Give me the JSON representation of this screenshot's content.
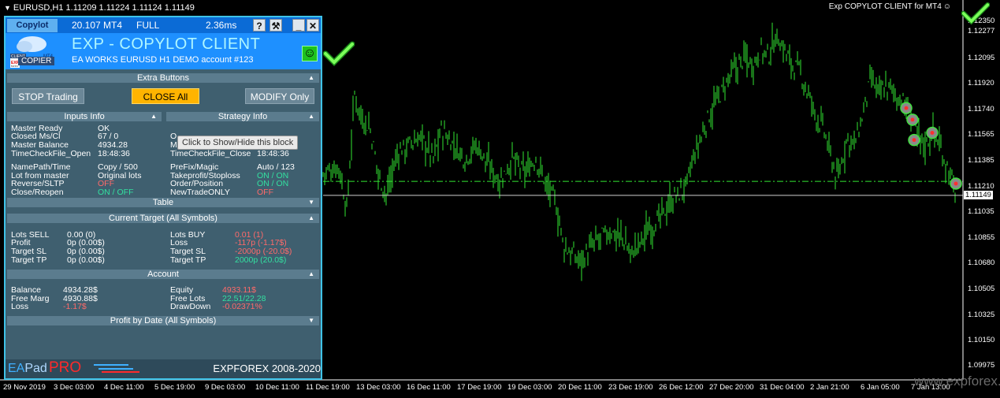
{
  "window": {
    "symbol_quote": "EURUSD,H1  1.11209 1.11224 1.11124 1.11149"
  },
  "chart_label": "Exp COPYLOT CLIENT for MT4",
  "panel": {
    "tab": "Copylot",
    "version": "20.107 MT4",
    "mode": "FULL",
    "ping": "2.36ms",
    "btn_help": "?",
    "btn_tools": "⚒",
    "btn_min": "_",
    "btn_close": "✕",
    "title": "EXP - COPYLOT CLIENT",
    "subtitle": "EA WORKS EURUSD  H1 DEMO account   #123",
    "copier": "COPIER",
    "logo_client": "CLIENT",
    "logo_mt4": "MT4",
    "logo_exp": "EXP",
    "logo_forex": "forex",
    "smile": "☺"
  },
  "sections": {
    "extra": "Extra Buttons",
    "inputs": "Inputs Info",
    "strategy": "Strategy Info",
    "table": "Table",
    "target": "Current Target (All Symbols)",
    "account": "Account",
    "profit": "Profit by Date (All Symbols)"
  },
  "buttons": {
    "stop": "STOP Trading",
    "close": "CLOSE All",
    "modify": "MODIFY Only"
  },
  "inputs": [
    {
      "label": "Master Ready",
      "value": "OK"
    },
    {
      "label": "Closed Ms/Cl",
      "value": "67 / 0"
    },
    {
      "label": "Master Balance",
      "value": "4934.28"
    },
    {
      "label": "TimeCheckFile_Open",
      "value": "18:48:36"
    },
    {
      "label": "NamePath/Time",
      "value": "Copy / 500"
    },
    {
      "label": "Lot from master",
      "value": "Original lots"
    },
    {
      "label": "Reverse/SLTP",
      "value": "OFF"
    },
    {
      "label": "Close/Reopen",
      "value": "ON / OFF"
    }
  ],
  "strategy": [
    {
      "label": "O",
      "value": ""
    },
    {
      "label": "M",
      "value": ""
    },
    {
      "label": "TimeCheckFile_Close",
      "value": "18:48:36"
    },
    {
      "label": "PreFix/Magic",
      "value": "Auto / 123"
    },
    {
      "label": "Takeprofit/Stoploss",
      "value": "ON / ON"
    },
    {
      "label": "Order/Position",
      "value": "ON / ON"
    },
    {
      "label": "NewTradeONLY",
      "value": "OFF"
    }
  ],
  "tooltip": "Click to Show/Hide this block",
  "target_left": [
    {
      "label": "Lots SELL",
      "value": "0.00 (0)"
    },
    {
      "label": "Profit",
      "value": "0p (0.00$)"
    },
    {
      "label": "Target SL",
      "value": "0p (0.00$)"
    },
    {
      "label": "Target TP",
      "value": "0p (0.00$)"
    }
  ],
  "target_right": [
    {
      "label": "Lots BUY",
      "value": "0.01 (1)"
    },
    {
      "label": "Loss",
      "value": "-117p (-1.17$)"
    },
    {
      "label": "Target SL",
      "value": "-2000p (-20.0$)"
    },
    {
      "label": "Target TP",
      "value": "2000p (20.0$)"
    }
  ],
  "account_left": [
    {
      "label": "Balance",
      "value": "4934.28$"
    },
    {
      "label": "Free Marg",
      "value": "4930.88$"
    },
    {
      "label": "Loss",
      "value": "-1.17$"
    }
  ],
  "account_right": [
    {
      "label": "Equity",
      "value": "4933.11$"
    },
    {
      "label": "Free Lots",
      "value": "22.51/22.28"
    },
    {
      "label": "DrawDown",
      "value": "-0.02371%"
    }
  ],
  "footer": {
    "ea": "EA",
    "pad": "Pad",
    "pro": "PRO",
    "copyright": "EXPFOREX 2008-2020"
  },
  "price_axis": [
    "1.12350",
    "1.12277",
    "1.12095",
    "1.11920",
    "1.11740",
    "1.11565",
    "1.11385",
    "1.11210",
    "1.11035",
    "1.10855",
    "1.10680",
    "1.10505",
    "1.10325",
    "1.10150",
    "1.09975"
  ],
  "current_price": "1.11149",
  "time_axis": [
    "29 Nov 2019",
    "3 Dec 03:00",
    "4 Dec 11:00",
    "5 Dec 19:00",
    "9 Dec 03:00",
    "10 Dec 11:00",
    "11 Dec 19:00",
    "13 Dec 03:00",
    "16 Dec 11:00",
    "17 Dec 19:00",
    "19 Dec 03:00",
    "20 Dec 11:00",
    "23 Dec 19:00",
    "26 Dec 12:00",
    "27 Dec 20:00",
    "31 Dec 04:00",
    "2 Jan 21:00",
    "6 Jan 05:00",
    "7 Jan 13:00"
  ],
  "watermark": "www.expforex.com",
  "colors": {
    "bars": "#32e632",
    "panel_border": "#3fc3e8",
    "header": "#1e90ff",
    "close_btn": "#ffb400"
  },
  "chart_data": {
    "type": "line",
    "x": [
      "29 Nov 2019",
      "3 Dec 03:00",
      "4 Dec 11:00",
      "5 Dec 19:00",
      "9 Dec 03:00",
      "10 Dec 11:00",
      "11 Dec 19:00",
      "13 Dec 03:00",
      "16 Dec 11:00",
      "17 Dec 19:00",
      "19 Dec 03:00",
      "20 Dec 11:00",
      "23 Dec 19:00",
      "26 Dec 12:00",
      "27 Dec 20:00",
      "31 Dec 04:00",
      "2 Jan 21:00",
      "6 Jan 05:00",
      "7 Jan 13:00"
    ],
    "ylim": [
      1.099,
      1.1244
    ],
    "price_samples": [
      [
        410,
        1.113
      ],
      [
        430,
        1.1135
      ],
      [
        440,
        1.1105
      ],
      [
        450,
        1.1185
      ],
      [
        458,
        1.117
      ],
      [
        470,
        1.116
      ],
      [
        480,
        1.113
      ],
      [
        490,
        1.1115
      ],
      [
        505,
        1.1145
      ],
      [
        520,
        1.115
      ],
      [
        535,
        1.1155
      ],
      [
        550,
        1.114
      ],
      [
        560,
        1.116
      ],
      [
        575,
        1.115
      ],
      [
        590,
        1.114
      ],
      [
        605,
        1.115
      ],
      [
        620,
        1.1135
      ],
      [
        635,
        1.1125
      ],
      [
        650,
        1.114
      ],
      [
        665,
        1.113
      ],
      [
        680,
        1.114
      ],
      [
        695,
        1.112
      ],
      [
        705,
        1.111
      ],
      [
        715,
        1.108
      ],
      [
        725,
        1.1075
      ],
      [
        735,
        1.107
      ],
      [
        745,
        1.1075
      ],
      [
        760,
        1.1085
      ],
      [
        775,
        1.109
      ],
      [
        790,
        1.1085
      ],
      [
        800,
        1.1075
      ],
      [
        810,
        1.108
      ],
      [
        820,
        1.109
      ],
      [
        830,
        1.1095
      ],
      [
        840,
        1.11
      ],
      [
        850,
        1.111
      ],
      [
        860,
        1.1115
      ],
      [
        870,
        1.112
      ],
      [
        880,
        1.114
      ],
      [
        890,
        1.1155
      ],
      [
        900,
        1.117
      ],
      [
        915,
        1.1185
      ],
      [
        930,
        1.12
      ],
      [
        945,
        1.121
      ],
      [
        955,
        1.1205
      ],
      [
        965,
        1.1215
      ],
      [
        975,
        1.121
      ],
      [
        985,
        1.1225
      ],
      [
        995,
        1.1215
      ],
      [
        1005,
        1.1205
      ],
      [
        1015,
        1.12
      ],
      [
        1025,
        1.1185
      ],
      [
        1035,
        1.117
      ],
      [
        1045,
        1.116
      ],
      [
        1055,
        1.114
      ],
      [
        1063,
        1.1125
      ],
      [
        1075,
        1.1155
      ],
      [
        1085,
        1.115
      ],
      [
        1095,
        1.117
      ],
      [
        1105,
        1.1195
      ],
      [
        1115,
        1.1185
      ],
      [
        1125,
        1.119
      ],
      [
        1135,
        1.1185
      ],
      [
        1145,
        1.118
      ],
      [
        1155,
        1.117
      ],
      [
        1165,
        1.1155
      ],
      [
        1175,
        1.115
      ],
      [
        1185,
        1.116
      ],
      [
        1195,
        1.1145
      ],
      [
        1205,
        1.113
      ],
      [
        1212,
        1.1118
      ]
    ],
    "current_price": 1.11149,
    "open_level": 1.11245,
    "grid": false,
    "markers": [
      [
        1150,
        1.1175
      ],
      [
        1158,
        1.1167
      ],
      [
        1160,
        1.1153
      ],
      [
        1183,
        1.1158
      ],
      [
        1213,
        1.1123
      ]
    ]
  }
}
